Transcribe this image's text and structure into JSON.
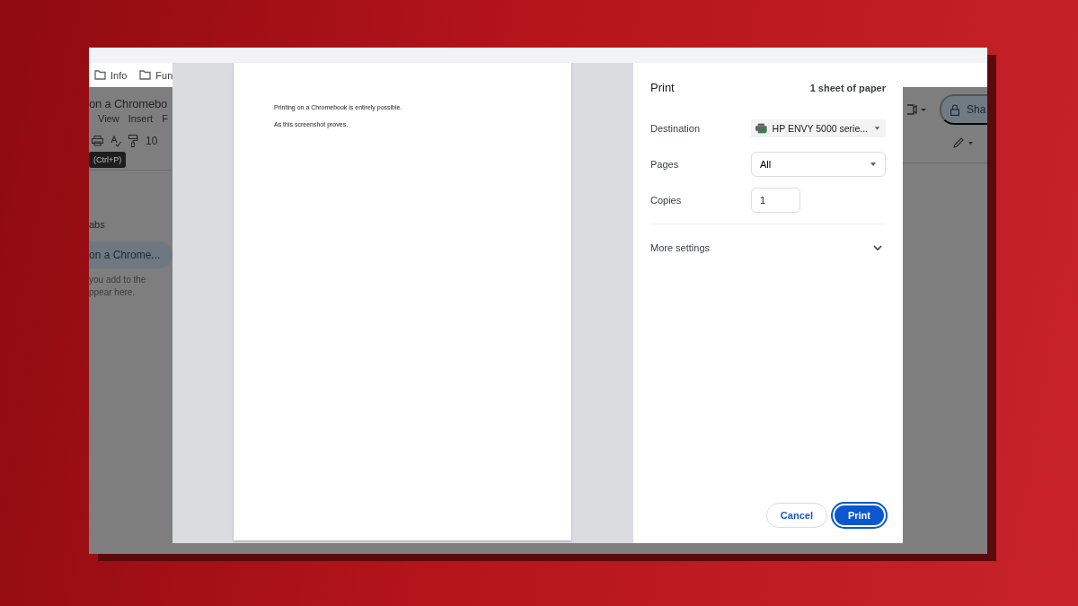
{
  "browser": {
    "bookmarks": [
      {
        "label": "Info"
      },
      {
        "label": "Fun"
      }
    ]
  },
  "document": {
    "title": "on a Chromebo",
    "menus": [
      "View",
      "Insert",
      "F"
    ],
    "zoom": "10",
    "tooltip": "(Ctrl+P)",
    "tabs_heading": "abs",
    "tab_item": "on a Chrome...",
    "hint_lines": [
      "you add to the",
      "ppear here."
    ],
    "share_label": "Sha"
  },
  "print_dialog": {
    "preview": {
      "lines": [
        "Printing on a Chromebook is entirely possible.",
        "As this screenshot proves."
      ]
    },
    "title": "Print",
    "sheet_count": "1 sheet of paper",
    "fields": [
      {
        "kind": "printer",
        "label": "Destination",
        "value": "HP ENVY 5000 serie..."
      },
      {
        "kind": "dropdown",
        "label": "Pages",
        "value": "All"
      },
      {
        "kind": "input",
        "label": "Copies",
        "value": "1"
      }
    ],
    "more_settings": {
      "label": "More settings",
      "expanded": false
    },
    "buttons": [
      {
        "label": "Cancel",
        "kind": "secondary"
      },
      {
        "label": "Print",
        "kind": "primary"
      }
    ]
  }
}
